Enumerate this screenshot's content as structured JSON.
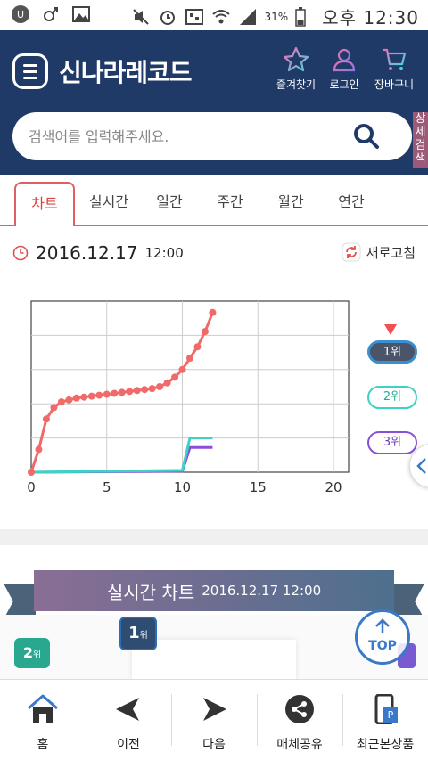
{
  "status_bar": {
    "battery": "31%",
    "time": "오후 12:30"
  },
  "header": {
    "brand": "신나라레코드",
    "actions": [
      {
        "label": "즐겨찾기",
        "icon": "star-icon"
      },
      {
        "label": "로그인",
        "icon": "user-icon"
      },
      {
        "label": "장바구니",
        "icon": "cart-icon"
      }
    ]
  },
  "search": {
    "placeholder": "검색어를 입력해주세요.",
    "advanced_label": "상세검색"
  },
  "tabs": [
    "차트",
    "실시간",
    "일간",
    "주간",
    "월간",
    "연간"
  ],
  "chart_header": {
    "date": "2016.12.17",
    "time": "12:00",
    "refresh_label": "새로고침"
  },
  "chart_data": {
    "type": "line",
    "xlim": [
      0,
      21
    ],
    "x_ticks": [
      "0",
      "5",
      "10",
      "15",
      "20"
    ],
    "grid": true,
    "series": [
      {
        "name": "1위",
        "color": "#f06a6a",
        "x": [
          0,
          0.5,
          1,
          1.5,
          2,
          2.5,
          3,
          3.5,
          4,
          4.5,
          5,
          5.5,
          6,
          6.5,
          7,
          7.5,
          8,
          8.5,
          9,
          9.5,
          10,
          10.5,
          11,
          11.5,
          12
        ],
        "y": [
          0,
          12,
          28,
          34,
          37,
          38,
          39,
          39.5,
          40,
          40.5,
          41,
          41.5,
          42,
          42.5,
          43,
          43.5,
          44,
          45,
          47,
          50,
          54,
          60,
          66,
          74,
          84
        ]
      },
      {
        "name": "2위",
        "color": "#3fd1c4",
        "x": [
          0,
          10,
          10.5,
          12
        ],
        "y": [
          0,
          1,
          18,
          18
        ]
      },
      {
        "name": "3위",
        "color": "#8a4fd8",
        "x": [
          0,
          10,
          10.5,
          12
        ],
        "y": [
          0,
          0.5,
          13,
          13
        ]
      }
    ],
    "legend": [
      "1위",
      "2위",
      "3위"
    ],
    "selected": "1위"
  },
  "banner": {
    "title": "실시간 차트",
    "date": "2016.12.17 12:00"
  },
  "ranks": {
    "first": "1",
    "second": "2",
    "suffix": "위"
  },
  "top_button": "TOP",
  "bottom_nav": [
    {
      "label": "홈",
      "icon": "home-icon"
    },
    {
      "label": "이전",
      "icon": "back-arrow-icon"
    },
    {
      "label": "다음",
      "icon": "forward-arrow-icon"
    },
    {
      "label": "매체공유",
      "icon": "share-icon"
    },
    {
      "label": "최근본상품",
      "icon": "recent-items-icon"
    }
  ]
}
